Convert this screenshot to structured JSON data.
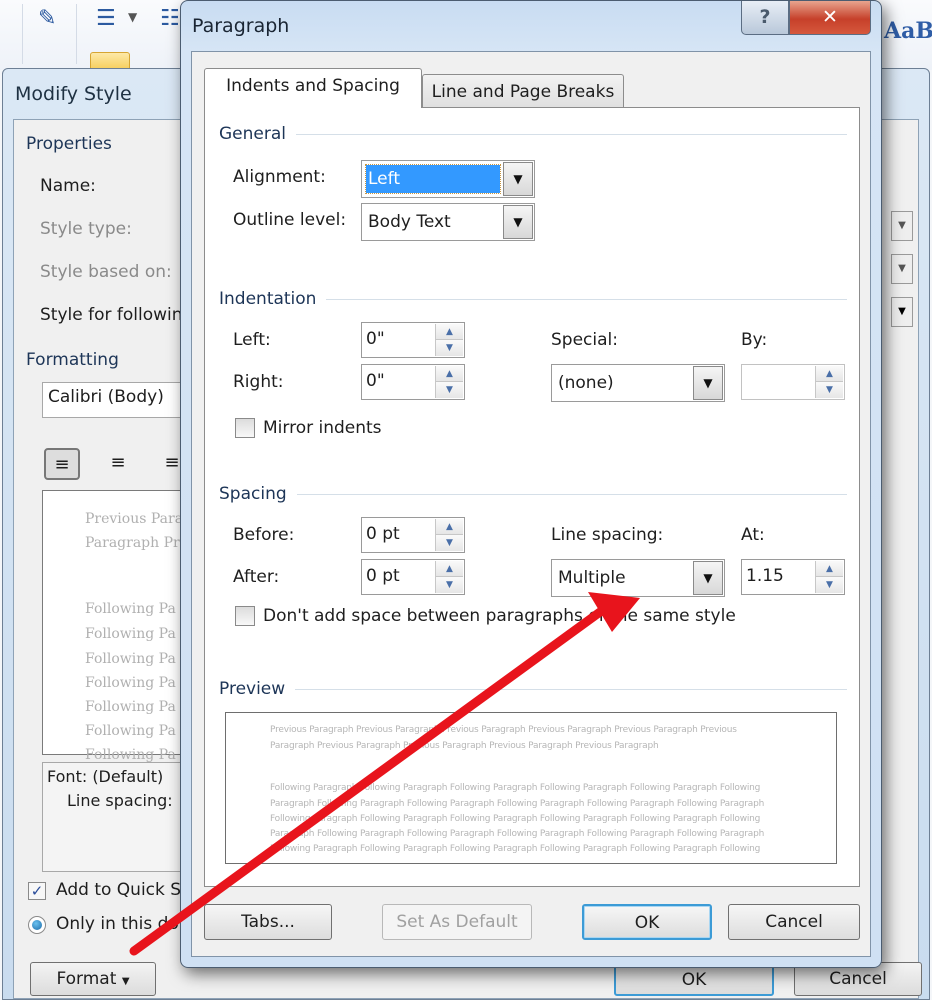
{
  "ribbon": {
    "icons": [
      "spelling-icon",
      "bullets-icon",
      "numbering-icon",
      "highlight-icon"
    ],
    "style_preview": "AaB"
  },
  "modify_style": {
    "title": "Modify Style",
    "properties_label": "Properties",
    "name_label": "Name:",
    "style_type_label": "Style type:",
    "style_based_on_label": "Style based on:",
    "style_following_label": "Style for followin",
    "formatting_label": "Formatting",
    "font_value": "Calibri (Body)",
    "preview_previous": [
      "Previous Para",
      "Paragraph Pre"
    ],
    "preview_following": [
      "Following Pa",
      "Following Pa",
      "Following Pa",
      "Following Pa",
      "Following Pa",
      "Following Pa",
      "Following Pa"
    ],
    "description": [
      "Font: (Default)",
      "Line spacing:"
    ],
    "add_quick_label": "Add to Quick S",
    "add_quick_checked": true,
    "only_doc_label": "Only in this do",
    "format_button": "Format",
    "ok_button": "OK",
    "cancel_button": "Cancel"
  },
  "paragraph": {
    "title": "Paragraph",
    "help_label": "?",
    "close_label": "✕",
    "tabs": [
      {
        "label": "Indents and Spacing",
        "active": true
      },
      {
        "label": "Line and Page Breaks",
        "active": false
      }
    ],
    "general": {
      "label": "General",
      "alignment_label": "Alignment:",
      "alignment_value": "Left",
      "outline_label": "Outline level:",
      "outline_value": "Body Text"
    },
    "indentation": {
      "label": "Indentation",
      "left_label": "Left:",
      "left_value": "0\"",
      "right_label": "Right:",
      "right_value": "0\"",
      "special_label": "Special:",
      "special_value": "(none)",
      "by_label": "By:",
      "by_value": "",
      "mirror_label": "Mirror indents",
      "mirror_checked": false
    },
    "spacing": {
      "label": "Spacing",
      "before_label": "Before:",
      "before_value": "0 pt",
      "after_label": "After:",
      "after_value": "0 pt",
      "line_spacing_label": "Line spacing:",
      "line_spacing_value": "Multiple",
      "at_label": "At:",
      "at_value": "1.15",
      "dont_add_label": "Don't add space between paragraphs of the same style",
      "dont_add_checked": false
    },
    "preview": {
      "label": "Preview",
      "previous_lines": [
        "Previous Paragraph Previous Paragraph Previous Paragraph Previous Paragraph Previous Paragraph Previous",
        "Paragraph Previous Paragraph Previous Paragraph Previous Paragraph Previous Paragraph"
      ],
      "following_lines": [
        "Following Paragraph Following Paragraph Following Paragraph Following Paragraph Following Paragraph Following",
        "Paragraph Following Paragraph Following Paragraph Following Paragraph Following Paragraph Following Paragraph",
        "Following Paragraph Following Paragraph Following Paragraph Following Paragraph Following Paragraph Following",
        "Paragraph Following Paragraph Following Paragraph Following Paragraph Following Paragraph Following Paragraph",
        "Following Paragraph Following Paragraph Following Paragraph Following Paragraph Following Paragraph Following"
      ]
    },
    "buttons": {
      "tabs": "Tabs...",
      "set_default": "Set As Default",
      "ok": "OK",
      "cancel": "Cancel"
    }
  },
  "annotation": {
    "color": "#e8141c"
  }
}
